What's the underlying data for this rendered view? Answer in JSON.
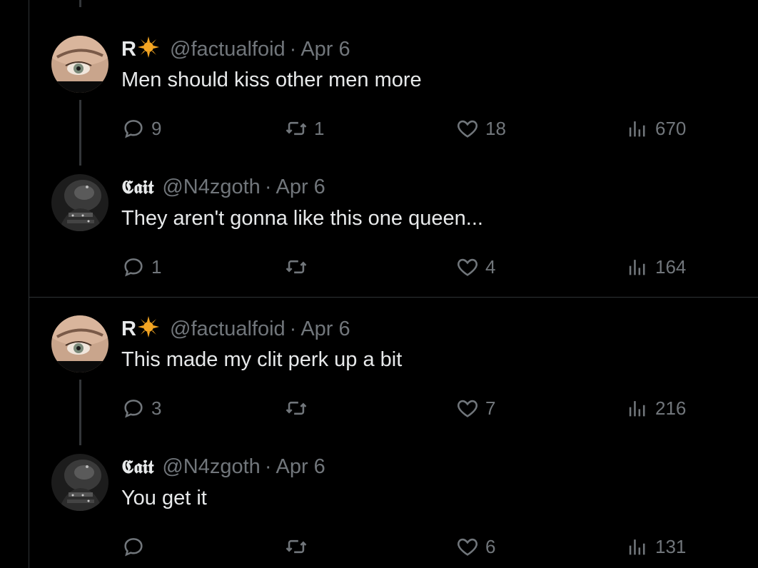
{
  "tweets": [
    {
      "name": "R",
      "handle": "@factualfoid",
      "dot": "·",
      "date": "Apr 6",
      "text": "Men should kiss other men more",
      "replies": "9",
      "retweets": "1",
      "likes": "18",
      "views": "670"
    },
    {
      "name": "𝕮𝖆𝖎𝖙",
      "handle": "@N4zgoth",
      "dot": "·",
      "date": "Apr 6",
      "text": "They aren't gonna like this one queen...",
      "replies": "1",
      "retweets": "",
      "likes": "4",
      "views": "164"
    },
    {
      "name": "R",
      "handle": "@factualfoid",
      "dot": "·",
      "date": "Apr 6",
      "text": "This made my clit perk up a bit",
      "replies": "3",
      "retweets": "",
      "likes": "7",
      "views": "216"
    },
    {
      "name": "𝕮𝖆𝖎𝖙",
      "handle": "@N4zgoth",
      "dot": "·",
      "date": "Apr 6",
      "text": "You get it",
      "replies": "",
      "retweets": "",
      "likes": "6",
      "views": "131"
    }
  ],
  "colors": {
    "background": "#000000",
    "text_primary": "#e7e9ea",
    "text_secondary": "#71767b",
    "border": "#2f3336",
    "sun_emoji": "#f5a623"
  },
  "icons": [
    "reply-icon",
    "retweet-icon",
    "like-icon",
    "views-icon",
    "sun-emoji-icon"
  ]
}
